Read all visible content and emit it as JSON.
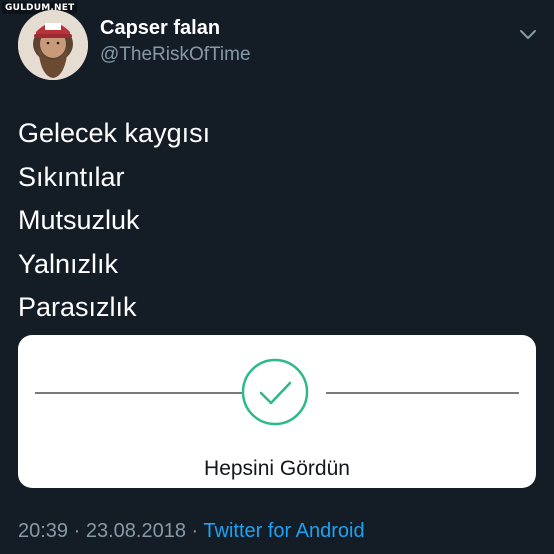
{
  "watermark": "GULDUM.NET",
  "user": {
    "name": "Capser falan",
    "handle": "@TheRiskOfTime"
  },
  "tweet": {
    "lines": [
      "Gelecek kaygısı",
      "Sıkıntılar",
      "Mutsuzluk",
      "Yalnızlık",
      "Parasızlık"
    ]
  },
  "card": {
    "label": "Hepsini Gördün",
    "check_color": "#2eb88c"
  },
  "meta": {
    "time": "20:39",
    "date": "23.08.2018",
    "separator": "·",
    "source": "Twitter for Android"
  },
  "icons": {
    "menu": "chevron-down-icon",
    "check": "check-circle-icon"
  },
  "colors": {
    "background": "#141d26",
    "secondary_text": "#8899a6",
    "link": "#1da1f2"
  }
}
